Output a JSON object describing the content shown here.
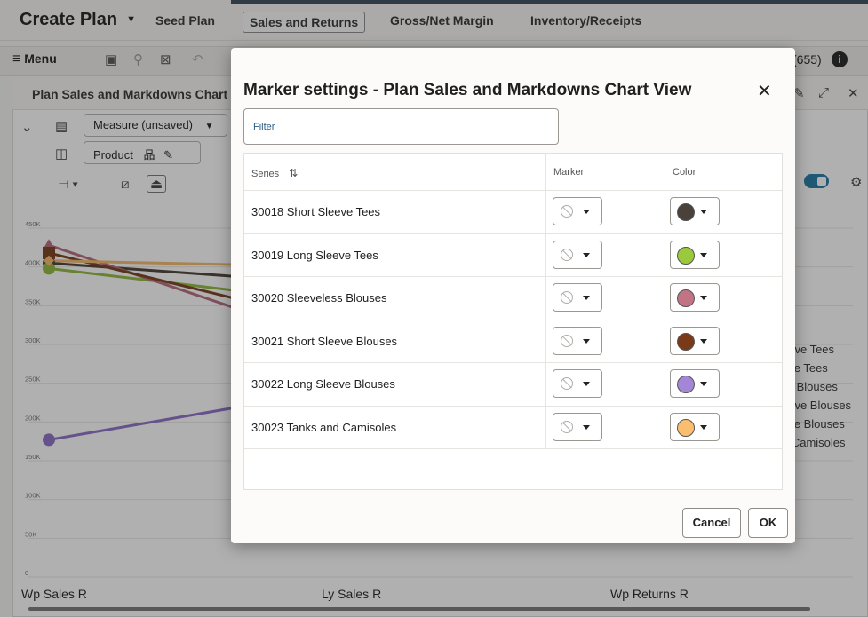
{
  "header": {
    "title": "Create Plan",
    "tabs": [
      {
        "label": "Seed Plan"
      },
      {
        "label": "Sales and Returns",
        "active": true
      },
      {
        "label": "Gross/Net Margin"
      },
      {
        "label": "Inventory/Receipts"
      }
    ]
  },
  "toolbar": {
    "menu_label": "Menu",
    "count_label": "(655)"
  },
  "panel": {
    "title": "Plan Sales and Markdowns Chart V",
    "measure_label": "Measure (unsaved)",
    "product_label": "Product"
  },
  "chart_data": {
    "type": "line",
    "categories": [
      "Wp Sales R",
      "Ly Sales R",
      "Wp Returns R"
    ],
    "y_ticks": [
      "0",
      "50K",
      "100K",
      "150K",
      "200K",
      "250K",
      "300K",
      "350K",
      "400K",
      "450K"
    ],
    "ylim": [
      0,
      450000
    ],
    "series": [
      {
        "name": "Short Sleeve Tees",
        "color": "#4a3f35",
        "values": [
          405000,
          null,
          null
        ]
      },
      {
        "name": "Long Sleeve Tees",
        "color": "#8fb83c",
        "values": [
          398000,
          null,
          null
        ]
      },
      {
        "name": "Sleeveless Blouses",
        "color": "#b76a7e",
        "values": [
          428000,
          null,
          null
        ]
      },
      {
        "name": "Short Sleeve Blouses",
        "color": "#7a3e1c",
        "values": [
          418000,
          null,
          null
        ]
      },
      {
        "name": "Long Sleeve Blouses",
        "color": "#8c6fc7",
        "values": [
          177000,
          null,
          null
        ]
      },
      {
        "name": "Tanks and Camisoles",
        "color": "#f3b86a",
        "values": [
          408000,
          null,
          null
        ]
      }
    ],
    "legend_visible_text": [
      "eeve Tees",
      "eve Tees",
      "ss Blouses",
      "eeve Blouses",
      "eve Blouses",
      "d Camisoles"
    ]
  },
  "dialog": {
    "title": "Marker settings - Plan Sales and Markdowns Chart View",
    "close_icon": "close-icon",
    "filter_placeholder": "Filter",
    "columns": {
      "series": "Series",
      "marker": "Marker",
      "color": "Color"
    },
    "sort_icon": "sort-icon",
    "rows": [
      {
        "label": "30018 Short Sleeve Tees",
        "color": "#4a423a"
      },
      {
        "label": "30019 Long Sleeve Tees",
        "color": "#9ac93c"
      },
      {
        "label": "30020 Sleeveless Blouses",
        "color": "#c07484"
      },
      {
        "label": "30021 Short Sleeve Blouses",
        "color": "#7a3a1a"
      },
      {
        "label": "30022 Long Sleeve Blouses",
        "color": "#a386d6"
      },
      {
        "label": "30023 Tanks and Camisoles",
        "color": "#fbbd6e"
      }
    ],
    "cancel_label": "Cancel",
    "ok_label": "OK"
  }
}
